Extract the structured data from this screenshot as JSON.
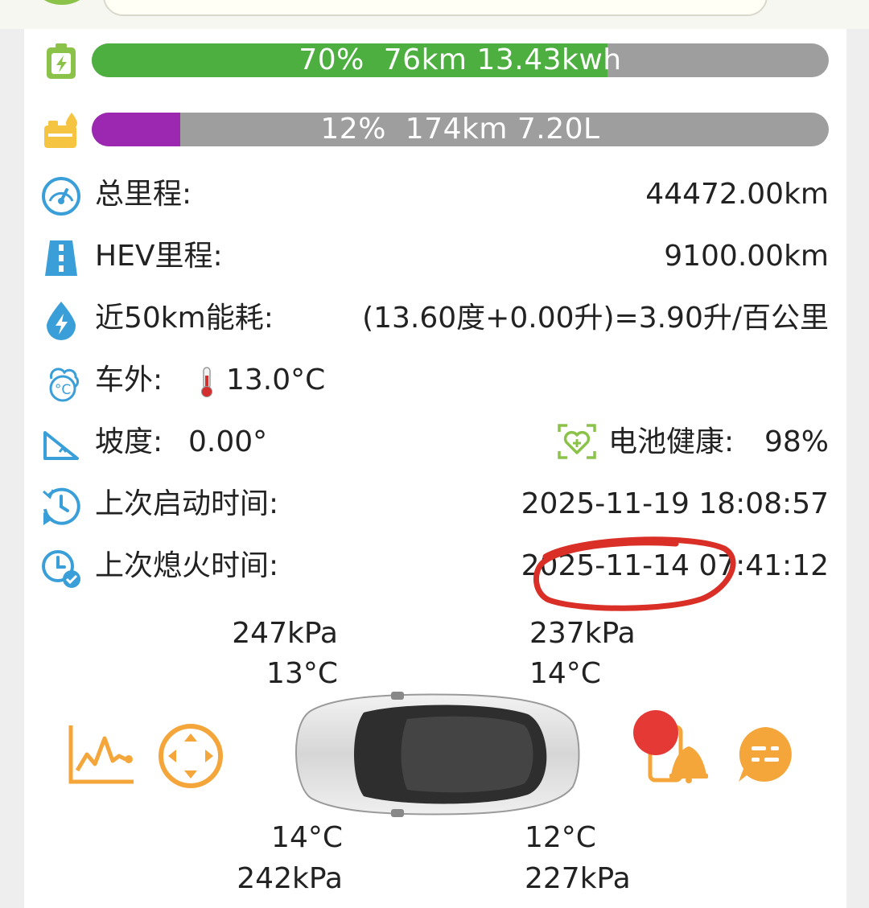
{
  "battery_bar": {
    "icon": "battery-charging-icon",
    "percent": 70,
    "text": "70%  76km 13.43kwh",
    "color": "#4caf3f"
  },
  "fuel_bar": {
    "icon": "fuel-tank-icon",
    "percent": 12,
    "text": "12%  174km 7.20L",
    "color": "#9c27b0"
  },
  "stats": {
    "total_mileage": {
      "label": "总里程:",
      "value": "44472.00km",
      "icon": "odometer-icon"
    },
    "hev_mileage": {
      "label": "HEV里程:",
      "value": "9100.00km",
      "icon": "road-icon"
    },
    "energy_50km": {
      "label": "近50km能耗:",
      "value": "(13.60度+0.00升)=3.90升/百公里",
      "icon": "energy-drop-icon"
    },
    "outside_temp": {
      "label": "车外:",
      "value": "13.0°C",
      "icon": "weather-icon",
      "thermo_icon": "thermometer-icon"
    },
    "slope": {
      "label": "坡度:",
      "value": "0.00°",
      "icon": "slope-icon"
    },
    "battery_health": {
      "label": "电池健康:",
      "value": "98%",
      "icon": "health-heart-icon"
    },
    "last_start": {
      "label": "上次启动时间:",
      "value": "2025-11-19 18:08:57",
      "icon": "clock-start-icon"
    },
    "last_off": {
      "label": "上次熄火时间:",
      "value": "2025-11-14 07:41:12",
      "icon": "clock-check-icon"
    }
  },
  "tires": {
    "front_left": {
      "pressure": "247kPa",
      "temp": "13°C"
    },
    "front_right": {
      "pressure": "237kPa",
      "temp": "14°C"
    },
    "rear_left": {
      "temp": "14°C",
      "pressure": "242kPa"
    },
    "rear_right": {
      "temp": "12°C",
      "pressure": "227kPa"
    }
  },
  "actions": {
    "chart": "line-chart-icon",
    "navigate": "direction-pad-icon",
    "alert": "phone-alert-icon",
    "message": "chat-icon"
  },
  "colors": {
    "accent_orange": "#f4a63a",
    "icon_blue": "#3a9fd8",
    "highlight_red": "#d92f26"
  }
}
